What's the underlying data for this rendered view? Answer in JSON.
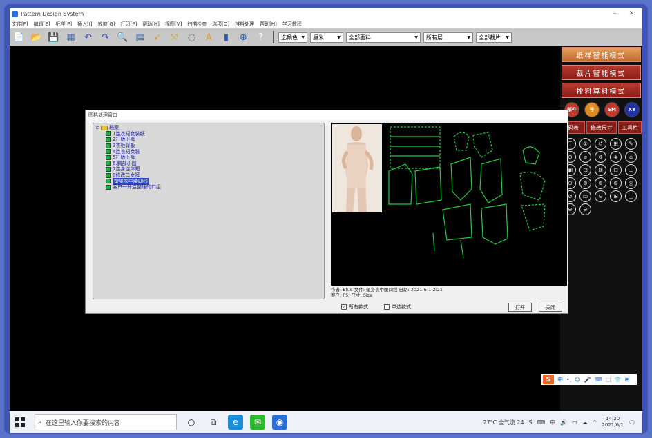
{
  "window": {
    "title": "Pattern Design System",
    "minimize": "–",
    "close": "✕"
  },
  "menu": [
    "文件[F]",
    "编辑[E]",
    "纸样[P]",
    "插入[I]",
    "放缩[G]",
    "打印[P]",
    "帮助[H]",
    "视图[V]",
    "扫描检查",
    "选项[O]",
    "排料处理",
    "帮助[H]",
    "学习教程"
  ],
  "toolbar": {
    "icons": [
      "new-icon",
      "open-icon",
      "save-icon",
      "import-icon",
      "undo-icon",
      "redo-icon",
      "zoom-icon",
      "grade-icon",
      "select-icon",
      "move-icon",
      "lasso-icon",
      "text-icon",
      "marker-icon",
      "point-icon",
      "help-icon"
    ],
    "glyphs": [
      "📄",
      "📂",
      "💾",
      "▦",
      "↶",
      "↷",
      "🔍",
      "▤",
      "➹",
      "⤧",
      "◌",
      "A",
      "▮",
      "⊕",
      "?"
    ],
    "combos": [
      {
        "label": "选颜色",
        "width": 42
      },
      {
        "label": "厘米",
        "width": 48
      },
      {
        "label": "全部面料",
        "width": 108
      },
      {
        "label": "所有层",
        "width": 72
      },
      {
        "label": "全部裁片",
        "width": 52
      }
    ]
  },
  "right_panel": {
    "modes": [
      "纸样智能模式",
      "裁片智能模式",
      "排料算料模式"
    ],
    "circles": [
      {
        "label": "部件",
        "color": "#c0392b"
      },
      {
        "label": "号",
        "color": "#e08a20"
      },
      {
        "label": "SM",
        "color": "#c0392b"
      },
      {
        "label": "XY",
        "color": "#2233aa"
      }
    ],
    "tabs": [
      "码表",
      "修改尺寸",
      "工具栏"
    ],
    "tools": [
      "T",
      "①",
      "↺",
      "⊞",
      "✎",
      "⊕",
      "⌀",
      "⊗",
      "◈",
      "⌂",
      "▣",
      "⊡",
      "⊠",
      "⊟",
      "⊥",
      "⊙",
      "⊚",
      "⊛",
      "⊜",
      "◎",
      "⊘",
      "▭",
      "⊝",
      "⊞",
      "▢",
      "⊕",
      "⊖"
    ]
  },
  "ime": {
    "logo": "S",
    "items": [
      "中",
      "•,",
      "☺",
      "🎤",
      "⌨",
      "⬚",
      "👕",
      "⊞"
    ]
  },
  "dialog": {
    "title": "图档处理窗口",
    "tree_root": "档案",
    "tree_items": [
      "1连衣裙女装纸",
      "2打版下裤",
      "3衣柜背板",
      "4连衣裙女装",
      "5打版下裤",
      "6.胸部小图",
      "7连身连体短",
      "8修改二女裤",
      "塑身衣中腰四线",
      "客户一开启整理的口组"
    ],
    "selected_index": 8,
    "info_line1": "作者: Blue 文件: 塑身衣中腰四线  日期: 2021-6-1 2:21",
    "info_line2": "客户: P5, 尺寸: Size",
    "check_all": "所有款式",
    "check_single": "单选款式",
    "open_btn": "打开",
    "cancel_btn": "关闭"
  },
  "taskbar": {
    "search_placeholder": "在这里输入你要搜索的内容",
    "apps": [
      {
        "name": "cortana-icon",
        "glyph": "○",
        "bg": "transparent"
      },
      {
        "name": "taskview-icon",
        "glyph": "⧉",
        "bg": "transparent"
      },
      {
        "name": "edge-icon",
        "glyph": "e",
        "bg": "#1a8cd8"
      },
      {
        "name": "wechat-icon",
        "glyph": "✉",
        "bg": "#2eb82e"
      },
      {
        "name": "pattern-app-icon",
        "glyph": "◉",
        "bg": "#2a6fd6"
      }
    ],
    "weather": "27°C 全气流 24",
    "time": "14:20",
    "date": "2021/6/1",
    "tray_icons": [
      "^",
      "☁",
      "▭",
      "🔊",
      "中",
      "⌨",
      "S"
    ]
  }
}
